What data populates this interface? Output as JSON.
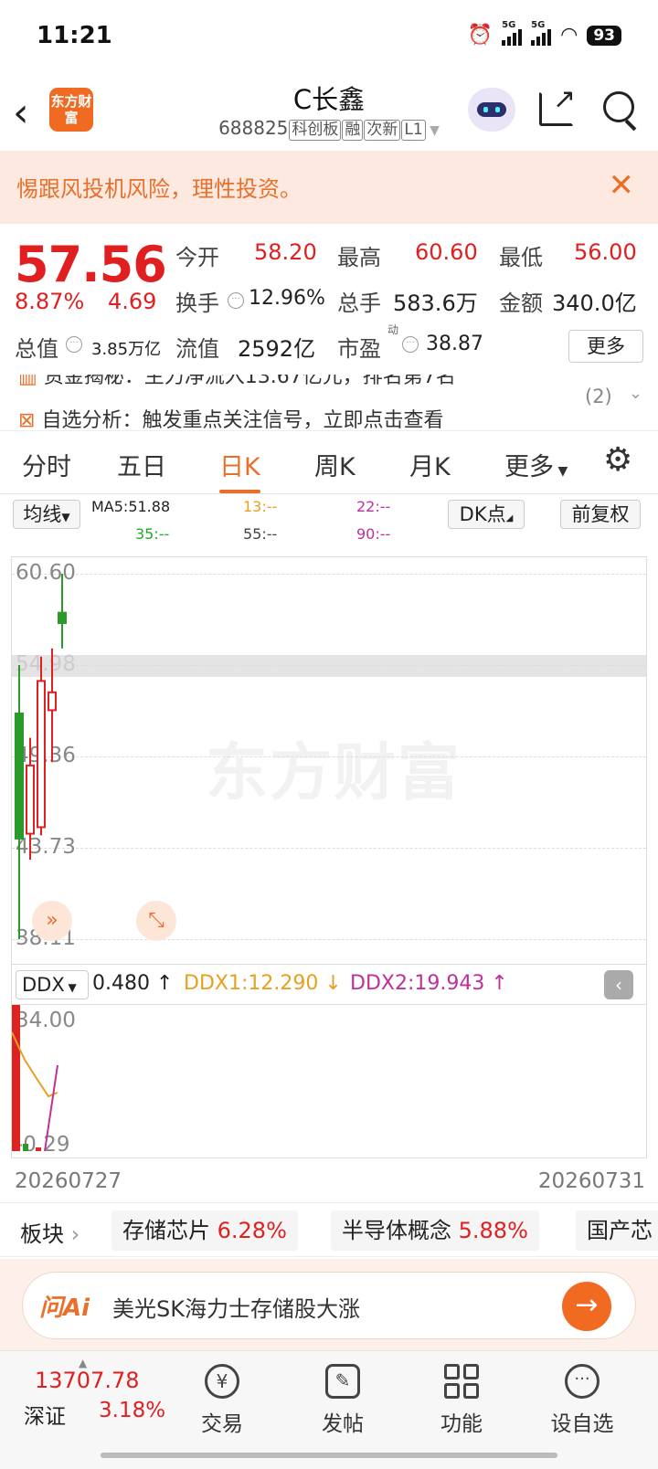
{
  "status": {
    "time": "11:21",
    "net1": "5G",
    "net2": "5G",
    "battery": "93"
  },
  "header": {
    "logo": "东方财富",
    "title": "C长鑫",
    "code": "688825",
    "tags": [
      "科创板",
      "融",
      "次新",
      "L1"
    ]
  },
  "notice": {
    "text": "惕跟风投机风险，理性投资。"
  },
  "quote": {
    "price": "57.56",
    "pct": "8.87%",
    "chg": "4.69",
    "open_label": "今开",
    "open": "58.20",
    "high_label": "最高",
    "high": "60.60",
    "low_label": "最低",
    "low": "56.00",
    "turnover_label": "换手",
    "turnover": "12.96%",
    "vol_label": "总手",
    "vol": "583.6万",
    "amount_label": "金额",
    "amount": "340.0亿",
    "mcap_label": "总值",
    "mcap": "3.85万亿",
    "float_label": "流值",
    "float": "2592亿",
    "pe_label": "市盈",
    "pe_sup": "动",
    "pe": "38.87",
    "more": "更多"
  },
  "news": {
    "line1": "资金揭秘：主力净流入13.67亿元，排名第7名",
    "line2": "自选分析：触发重点关注信号，立即点击查看",
    "count": "(2)"
  },
  "tabs": [
    "分时",
    "五日",
    "日K",
    "周K",
    "月K",
    "更多"
  ],
  "ma": {
    "btn": "均线",
    "ma5": "MA5:51.88",
    "ma13": "13:--",
    "ma22": "22:--",
    "ma35": "35:--",
    "ma55": "55:--",
    "ma90": "90:--",
    "dk": "DK点",
    "fq": "前复权",
    "c5": "#222222",
    "c13": "#e8a020",
    "c22": "#c0309a",
    "c35": "#22aa22"
  },
  "chart_data": {
    "type": "candlestick",
    "y_ticks": [
      "60.60",
      "54.98",
      "49.36",
      "43.73",
      "38.11"
    ],
    "ylim": [
      38.11,
      60.6
    ],
    "candles": [
      {
        "open": 52.0,
        "close": 44.3,
        "high": 54.98,
        "low": 38.11
      },
      {
        "open": 44.6,
        "close": 48.8,
        "high": 50.5,
        "low": 43.0
      },
      {
        "open": 45.0,
        "close": 54.0,
        "high": 55.5,
        "low": 44.5
      },
      {
        "open": 52.2,
        "close": 53.3,
        "high": 56.0,
        "low": 49.0
      },
      {
        "open": 58.2,
        "close": 57.56,
        "high": 60.6,
        "low": 56.0
      }
    ],
    "ddx": {
      "label": "DDX",
      "value": "0.480 ↑",
      "ddx1": "DDX1:12.290 ↓",
      "ddx2": "DDX2:19.943 ↑",
      "top": "34.00",
      "bottom": "-0.29"
    },
    "x_start": "20260727",
    "x_end": "20260731"
  },
  "watermark": "东方财富",
  "sector": {
    "label": "板块",
    "items": [
      {
        "name": "存储芯片",
        "pct": "6.28%"
      },
      {
        "name": "半导体概念",
        "pct": "5.88%"
      },
      {
        "name": "国产芯"
      }
    ]
  },
  "ai": {
    "logo": "问Ai",
    "text": "美光SK海力士存储股大涨"
  },
  "bottom": {
    "index": "13707.78",
    "index_name": "深证",
    "index_pct": "3.18%",
    "nav": [
      "交易",
      "发帖",
      "功能",
      "设自选"
    ]
  },
  "colors": {
    "up": "#e02020",
    "down": "#2a9a2a",
    "accent": "#e8702a"
  }
}
